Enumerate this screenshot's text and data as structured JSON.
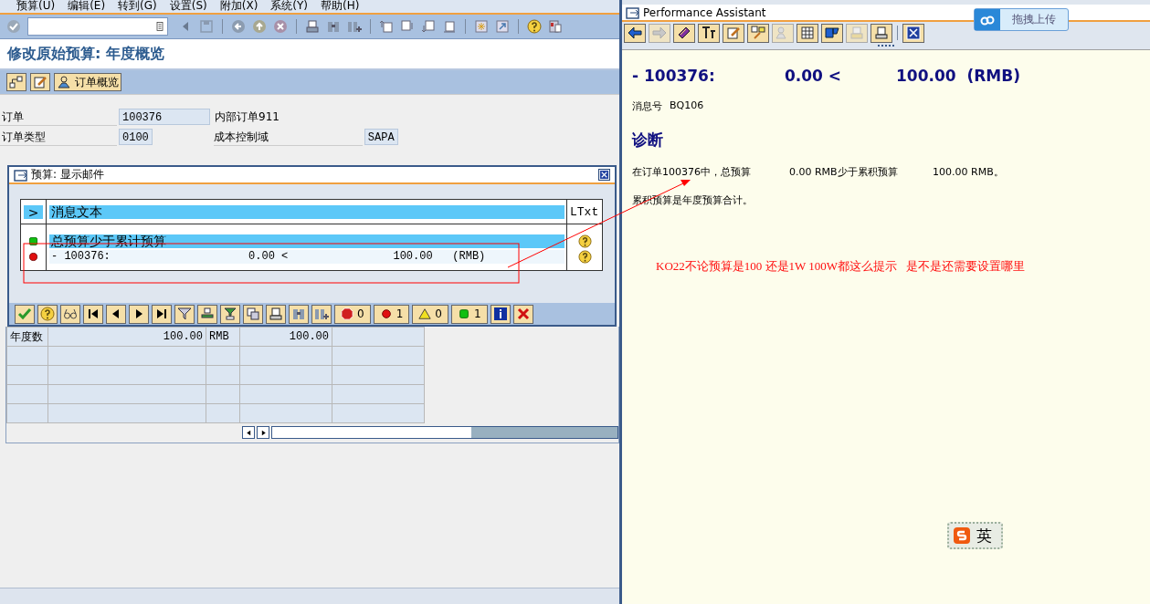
{
  "menu_bar": [
    "预算(U)",
    "编辑(E)",
    "转到(G)",
    "设置(S)",
    "附加(X)",
    "系统(Y)",
    "帮助(H)"
  ],
  "screen_title": "修改原始预算: 年度概览",
  "app_toolbar": {
    "overview_button": "订单概览"
  },
  "header": {
    "order": {
      "label": "订单",
      "value": "100376",
      "text": "内部订单911"
    },
    "order_type": {
      "label": "订单类型",
      "value": "0100"
    },
    "controlling_area": {
      "label": "成本控制域",
      "value": "SAPA"
    }
  },
  "budget_table": {
    "rows": [
      {
        "column_1": "年度数",
        "column_2": "100.00",
        "column_3": "RMB",
        "column_4": "100.00"
      },
      {},
      {},
      {},
      {}
    ]
  },
  "popup": {
    "title": "预算: 显示邮件",
    "expand": ">",
    "column_1": "消息文本",
    "column_2": "LTxt",
    "messages": [
      {
        "kind": "success",
        "text": "总预算少于累计预算",
        "selected": true
      },
      {
        "kind": "error",
        "text": "- 100376:                     0.00 <                100.00   (RMB)",
        "selected": false
      }
    ],
    "counters": [
      {
        "kind": "stop",
        "count": "0"
      },
      {
        "kind": "error",
        "count": "1"
      },
      {
        "kind": "warning",
        "count": "0"
      },
      {
        "kind": "success",
        "count": "1"
      }
    ]
  },
  "assistant": {
    "title": "Performance Assistant",
    "heading": [
      "- 100376:",
      "0.00 <",
      "100.00  (RMB)"
    ],
    "message_number": {
      "label": "消息号",
      "value": "BQ106"
    },
    "section": "诊断",
    "paragraphs": [
      "在订单100376中，总预算            0.00 RMB少于累积预算           100.00 RMB。",
      "累积预算是年度预算合计。"
    ],
    "note": "KO22不论预算是100 还是1W 100W都这么提示   是不是还需要设置哪里"
  },
  "upload_button": "拖拽上传",
  "input_method": "英"
}
